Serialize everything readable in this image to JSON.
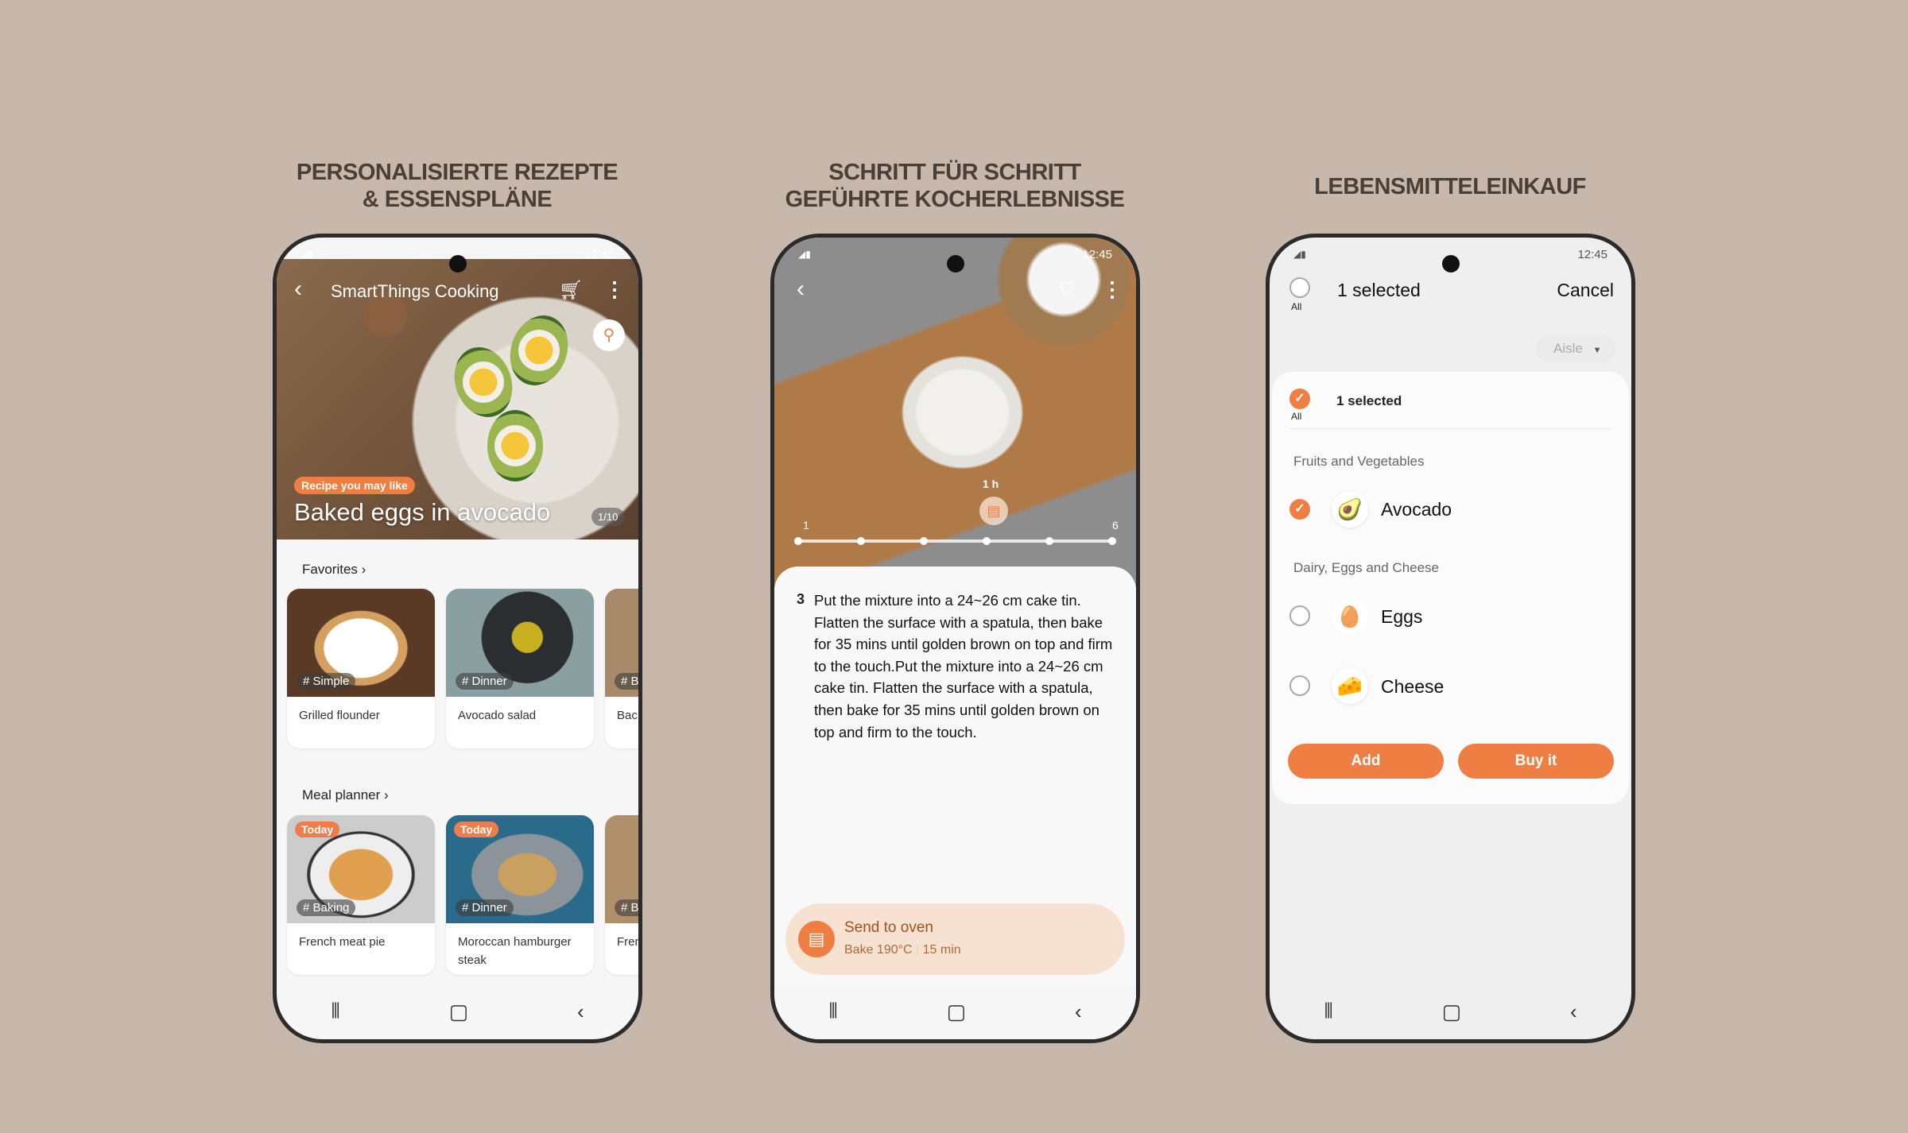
{
  "headings": [
    "PERSONALISIERTE REZEPTE",
    "& ESSENSPLÄNE",
    "SCHRITT FÜR SCHRITT",
    "GEFÜHRTE KOCHERLEBNISSE",
    "LEBENSMITTELEINKAUF"
  ],
  "status": {
    "time": "12:45"
  },
  "colors": {
    "accent": "#ef7e43",
    "background": "#c8b8ab"
  },
  "phone1": {
    "app_title": "SmartThings Cooking",
    "badge": "Recipe you may like",
    "recipe_title": "Baked eggs in avocado",
    "pager": "1/10",
    "favorites": {
      "title": "Favorites",
      "cards": [
        {
          "tag": "# Simple",
          "name": "Grilled flounder"
        },
        {
          "tag": "# Dinner",
          "name": "Avocado salad"
        },
        {
          "tag": "# B",
          "name": "Bac"
        }
      ]
    },
    "meal_planner": {
      "title": "Meal planner",
      "badge": "Today",
      "cards": [
        {
          "tag": "# Baking",
          "name": "French meat pie"
        },
        {
          "tag": "# Dinner",
          "name": "Moroccan hamburger steak"
        },
        {
          "tag": "# B",
          "name": "Fren"
        }
      ]
    }
  },
  "phone2": {
    "timer": "1 h",
    "step_start": "1",
    "step_end": "6",
    "step_number": "3",
    "step_text": "Put the mixture into a 24~26 cm cake tin. Flatten the surface with a spatula, then bake for 35 mins until golden brown on top and firm to the touch.Put the mixture into a 24~26 cm cake tin. Flatten the surface with a spatula, then bake for 35 mins until golden brown on top and firm to the touch.",
    "oven_title": "Send to oven",
    "oven_mode": "Bake 190°C",
    "oven_time": "15 min"
  },
  "phone3": {
    "header_selected": "1 selected",
    "all": "All",
    "cancel": "Cancel",
    "sort": "Aisle",
    "list_selected": "1 selected",
    "categories": [
      {
        "name": "Fruits and Vegetables",
        "items": [
          {
            "name": "Avocado",
            "checked": true,
            "icon": "avocado"
          }
        ]
      },
      {
        "name": "Dairy, Eggs and Cheese",
        "items": [
          {
            "name": "Eggs",
            "checked": false,
            "icon": "eggs"
          },
          {
            "name": "Cheese",
            "checked": false,
            "icon": "cheese"
          }
        ]
      }
    ],
    "add": "Add",
    "buy": "Buy it"
  }
}
